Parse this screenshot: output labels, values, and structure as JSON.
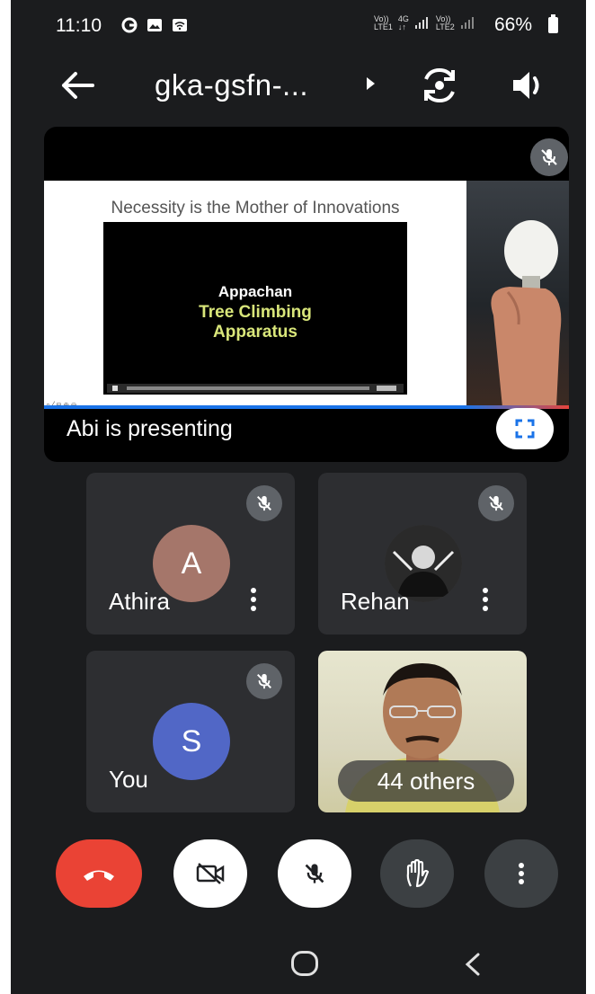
{
  "status_bar": {
    "time": "11:10",
    "left_icons": [
      "google-icon",
      "gallery-icon",
      "wifi-icon"
    ],
    "network_1_top": "Vo))",
    "network_1_bottom": "LTE1",
    "network_2_top": "4G",
    "network_2_bottom": "↓↑",
    "network_3_top": "Vo))",
    "network_3_bottom": "LTE2",
    "battery": "66%"
  },
  "header": {
    "meeting_code": "gka-gsfn-...",
    "icons": [
      "back-arrow-icon",
      "camera-switch-icon",
      "speaker-icon"
    ]
  },
  "presentation": {
    "slide_title": "Necessity is the Mother of Innovations",
    "video_line1": "Appachan",
    "video_line2": "Tree Climbing",
    "video_line3": "Apparatus",
    "slide_tools": "⌕ ⁄ ⊟ ⊕ ⊖",
    "presenter_label": "Abi is presenting"
  },
  "participants": [
    {
      "name": "Athira",
      "initial": "A",
      "avatar_color": "#a5766a",
      "muted": true
    },
    {
      "name": "Rehan",
      "initial": "",
      "avatar_color": "#3a3a3a",
      "muted": true
    },
    {
      "name": "You",
      "initial": "S",
      "avatar_color": "#5167c6",
      "muted": true
    }
  ],
  "others_tile": {
    "label": "44 others"
  },
  "controls": {
    "colors": {
      "end_call": "#ea4335",
      "light": "#ffffff",
      "dark": "#3c4043"
    }
  }
}
